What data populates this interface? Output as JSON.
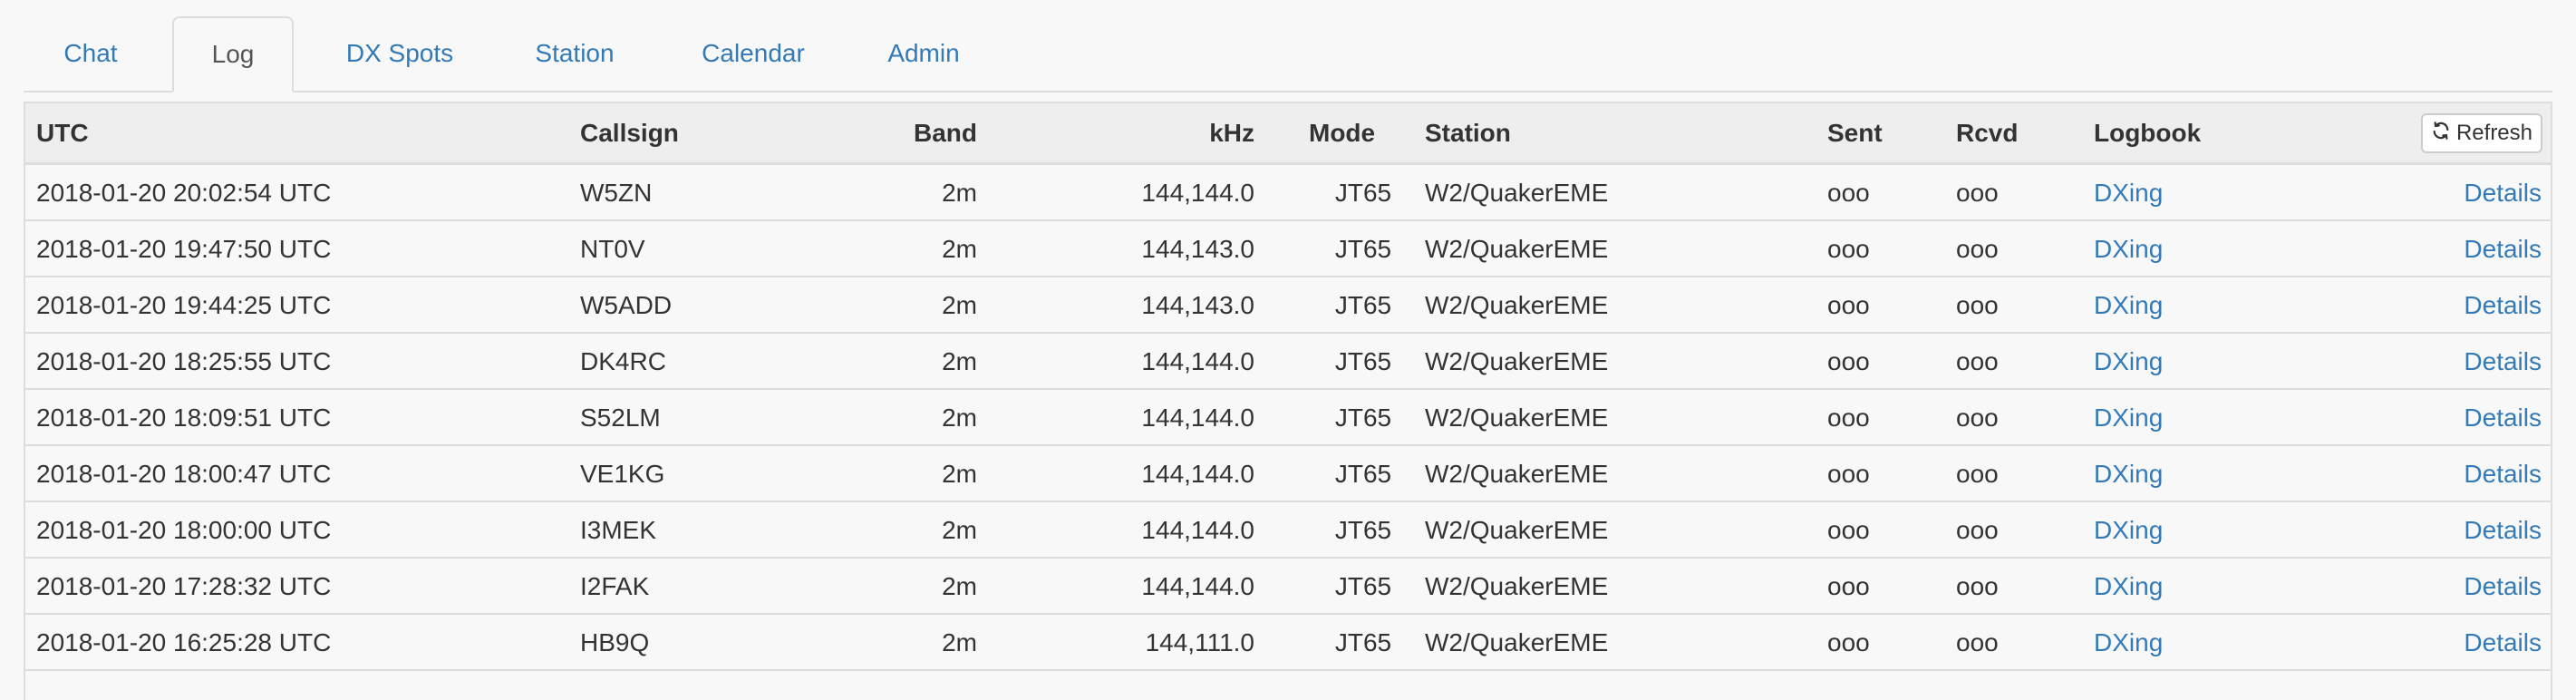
{
  "tabs": [
    {
      "label": "Chat"
    },
    {
      "label": "Log"
    },
    {
      "label": "DX Spots"
    },
    {
      "label": "Station"
    },
    {
      "label": "Calendar"
    },
    {
      "label": "Admin"
    }
  ],
  "active_tab": "Log",
  "table": {
    "headers": {
      "utc": "UTC",
      "callsign": "Callsign",
      "band": "Band",
      "khz": "kHz",
      "mode": "Mode",
      "station": "Station",
      "sent": "Sent",
      "rcvd": "Rcvd",
      "logbook": "Logbook"
    },
    "refresh_label": "Refresh",
    "rows": [
      {
        "utc": "2018-01-20 20:02:54 UTC",
        "callsign": "W5ZN",
        "band": "2m",
        "khz": "144,144.0",
        "mode": "JT65",
        "station": "W2/QuakerEME",
        "sent": "ooo",
        "rcvd": "ooo",
        "logbook": "DXing",
        "details": "Details"
      },
      {
        "utc": "2018-01-20 19:47:50 UTC",
        "callsign": "NT0V",
        "band": "2m",
        "khz": "144,143.0",
        "mode": "JT65",
        "station": "W2/QuakerEME",
        "sent": "ooo",
        "rcvd": "ooo",
        "logbook": "DXing",
        "details": "Details"
      },
      {
        "utc": "2018-01-20 19:44:25 UTC",
        "callsign": "W5ADD",
        "band": "2m",
        "khz": "144,143.0",
        "mode": "JT65",
        "station": "W2/QuakerEME",
        "sent": "ooo",
        "rcvd": "ooo",
        "logbook": "DXing",
        "details": "Details"
      },
      {
        "utc": "2018-01-20 18:25:55 UTC",
        "callsign": "DK4RC",
        "band": "2m",
        "khz": "144,144.0",
        "mode": "JT65",
        "station": "W2/QuakerEME",
        "sent": "ooo",
        "rcvd": "ooo",
        "logbook": "DXing",
        "details": "Details"
      },
      {
        "utc": "2018-01-20 18:09:51 UTC",
        "callsign": "S52LM",
        "band": "2m",
        "khz": "144,144.0",
        "mode": "JT65",
        "station": "W2/QuakerEME",
        "sent": "ooo",
        "rcvd": "ooo",
        "logbook": "DXing",
        "details": "Details"
      },
      {
        "utc": "2018-01-20 18:00:47 UTC",
        "callsign": "VE1KG",
        "band": "2m",
        "khz": "144,144.0",
        "mode": "JT65",
        "station": "W2/QuakerEME",
        "sent": "ooo",
        "rcvd": "ooo",
        "logbook": "DXing",
        "details": "Details"
      },
      {
        "utc": "2018-01-20 18:00:00 UTC",
        "callsign": "I3MEK",
        "band": "2m",
        "khz": "144,144.0",
        "mode": "JT65",
        "station": "W2/QuakerEME",
        "sent": "ooo",
        "rcvd": "ooo",
        "logbook": "DXing",
        "details": "Details"
      },
      {
        "utc": "2018-01-20 17:28:32 UTC",
        "callsign": "I2FAK",
        "band": "2m",
        "khz": "144,144.0",
        "mode": "JT65",
        "station": "W2/QuakerEME",
        "sent": "ooo",
        "rcvd": "ooo",
        "logbook": "DXing",
        "details": "Details"
      },
      {
        "utc": "2018-01-20 16:25:28 UTC",
        "callsign": "HB9Q",
        "band": "2m",
        "khz": "144,111.0",
        "mode": "JT65",
        "station": "W2/QuakerEME",
        "sent": "ooo",
        "rcvd": "ooo",
        "logbook": "DXing",
        "details": "Details"
      }
    ]
  },
  "colors": {
    "link": "#337ab7",
    "header_bg": "#eeeeee",
    "border": "#dddddd"
  },
  "icons": {
    "refresh": "refresh-icon"
  }
}
